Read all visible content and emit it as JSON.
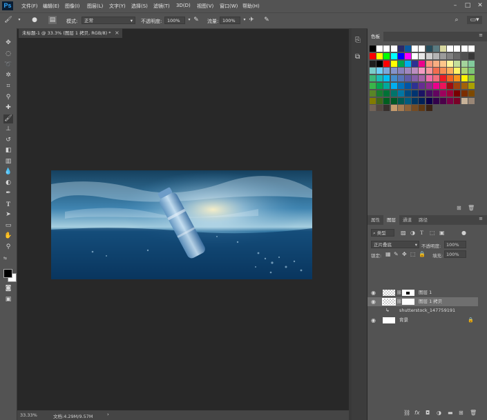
{
  "app": {
    "logo": "Ps"
  },
  "menu": [
    "文件(F)",
    "编辑(E)",
    "图像(I)",
    "图层(L)",
    "文字(Y)",
    "选择(S)",
    "滤镜(T)",
    "3D(D)",
    "视图(V)",
    "窗口(W)",
    "帮助(H)"
  ],
  "options": {
    "mode_label": "模式:",
    "mode_value": "正常",
    "opacity_label": "不透明度:",
    "opacity_value": "100%",
    "flow_label": "流量:",
    "flow_value": "100%"
  },
  "document": {
    "tab_title": "未标题-1 @ 33.3% (图层 1 拷贝, RGB/8) *",
    "close": "×"
  },
  "status": {
    "zoom": "33.33%",
    "doc_info": "文档:4.29M/9.57M"
  },
  "swatches_panel": {
    "title": "色板"
  },
  "swatch_colors": [
    [
      "#000000",
      "#ffffff",
      "#ffffff",
      "#ffffff",
      "#2a2a6a",
      "#0a5aa0",
      "#ffffff",
      "#ffffff",
      "#264d5c",
      "#5a7a80",
      "#d8d8a0",
      "#ffffff",
      "#ffffff",
      "#ffffff",
      "#ffffff"
    ],
    [
      "#ff0000",
      "#ffff00",
      "#00ff00",
      "#00ffff",
      "#0000ff",
      "#ff00ff",
      "#ffffff",
      "#e6e6e6",
      "#cdcdcd",
      "#b4b4b4",
      "#9b9b9b",
      "#828282",
      "#696969",
      "#505050",
      "#373737"
    ],
    [
      "#1e1e1e",
      "#000000",
      "#ff0000",
      "#ffff00",
      "#00a651",
      "#00aeef",
      "#2e3192",
      "#ec008c",
      "#f7977a",
      "#f9ad81",
      "#fdc68a",
      "#fff79a",
      "#c4df9b",
      "#a3d39c",
      "#82ca9c"
    ],
    [
      "#7accc8",
      "#6dcff6",
      "#7da7d9",
      "#8493ca",
      "#8882be",
      "#a187be",
      "#bc8dbf",
      "#f49ac2",
      "#f6989d",
      "#f26c4f",
      "#f68e55",
      "#fbaf5c",
      "#fff467",
      "#acd372",
      "#7cc576"
    ],
    [
      "#3bb878",
      "#1abbb4",
      "#00bff3",
      "#438ccb",
      "#5574b9",
      "#605ca8",
      "#855fa8",
      "#a763a8",
      "#f06ea9",
      "#f26d7d",
      "#ed1c24",
      "#f26522",
      "#f7941d",
      "#fff200",
      "#8dc63f"
    ],
    [
      "#39b54a",
      "#00a651",
      "#00a99d",
      "#00aeef",
      "#0072bc",
      "#0054a6",
      "#2e3192",
      "#662d91",
      "#92278f",
      "#ec008c",
      "#ed145b",
      "#9e0b0f",
      "#a0410d",
      "#a36209",
      "#aba000"
    ],
    [
      "#598527",
      "#197b30",
      "#007236",
      "#00746b",
      "#0076a3",
      "#004a80",
      "#003471",
      "#1b1464",
      "#440e62",
      "#630460",
      "#9e005d",
      "#9e0039",
      "#790000",
      "#7b2e00",
      "#7d4900"
    ],
    [
      "#827b00",
      "#406618",
      "#005e20",
      "#005826",
      "#005952",
      "#005b7f",
      "#003663",
      "#002157",
      "#0d004c",
      "#32004b",
      "#4b0049",
      "#7b0046",
      "#7a0026",
      "#c7b299",
      "#998675"
    ],
    [
      "#736357",
      "#534741",
      "#37302d",
      "#c69c6d",
      "#a67c52",
      "#8c6239",
      "#754c24",
      "#603913",
      "#3c2415"
    ]
  ],
  "layers_panel": {
    "tabs": [
      "属性",
      "图层",
      "通道",
      "路径"
    ],
    "filter": "类型",
    "blend_mode": "正片叠底",
    "opacity_label": "不透明度:",
    "opacity_value": "100%",
    "lock_label": "锁定:",
    "fill_label": "填充:",
    "fill_value": "100%",
    "layers": [
      {
        "name": "图层 1"
      },
      {
        "name": "图层 1 拷贝"
      },
      {
        "name": "shutterstock_147759191"
      },
      {
        "name": "背景"
      }
    ]
  }
}
